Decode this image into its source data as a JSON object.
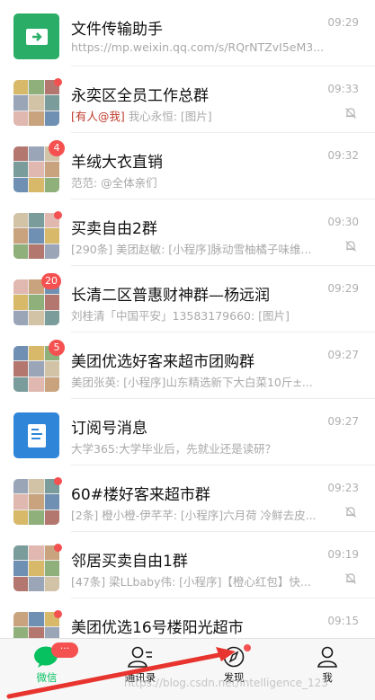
{
  "chats": [
    {
      "title": "文件传输助手",
      "subtitle": "https://mp.weixin.qq.com/s/RQrNTZvI5eM3...",
      "time": "09:29",
      "muted": false,
      "badge": "",
      "dot": false,
      "avatar_icon": "file-transfer-icon",
      "avatar_color": "#2aae67"
    },
    {
      "title": "永奕区全员工作总群",
      "mention": "[有人@我]",
      "subtitle": " 我心永恒: [图片]",
      "time": "09:33",
      "muted": true,
      "badge": "",
      "dot": true,
      "avatar_icon": "group-avatar"
    },
    {
      "title": "羊绒大衣直销",
      "subtitle": "范范: @全体亲们",
      "time": "09:32",
      "muted": false,
      "badge": "4",
      "dot": false,
      "avatar_icon": "group-avatar"
    },
    {
      "title": "买卖自由2群",
      "subtitle": "[290条] 美团赵敏: [小程序]脉动雪柚橘子味维...",
      "time": "09:30",
      "muted": true,
      "badge": "",
      "dot": true,
      "avatar_icon": "group-avatar"
    },
    {
      "title": "长清二区普惠财神群—杨远润",
      "subtitle": "刘桂清「中国平安」13583179660: [图片]",
      "time": "09:29",
      "muted": false,
      "badge": "20",
      "dot": false,
      "avatar_icon": "group-avatar"
    },
    {
      "title": "美团优选好客来超市团购群",
      "subtitle": "美团张英: [小程序]山东精选新下大白菜10斤±...",
      "time": "09:27",
      "muted": false,
      "badge": "5",
      "dot": false,
      "avatar_icon": "group-avatar"
    },
    {
      "title": "订阅号消息",
      "subtitle": "大学365:大学毕业后，先就业还是读研？",
      "time": "09:27",
      "muted": false,
      "badge": "",
      "dot": false,
      "avatar_icon": "subscription-icon",
      "avatar_color": "#2f86d8"
    },
    {
      "title": "60#楼好客来超市群",
      "subtitle": "[2条] 橙小橙-伊芊芊: [小程序]六月荷 冷鲜去皮...",
      "time": "09:23",
      "muted": true,
      "badge": "",
      "dot": true,
      "avatar_icon": "group-avatar"
    },
    {
      "title": "邻居买卖自由1群",
      "subtitle": "[47条] 梁LLbaby伟: [小程序]【橙心红包】快...",
      "time": "09:19",
      "muted": true,
      "badge": "",
      "dot": true,
      "avatar_icon": "group-avatar"
    },
    {
      "title": "美团优选16号楼阳光超市",
      "subtitle": "",
      "time": "09:15",
      "muted": false,
      "badge": "",
      "dot": true,
      "avatar_icon": "group-avatar"
    }
  ],
  "tabs": [
    {
      "label": "微信",
      "icon": "chat-bubble-icon",
      "active": true
    },
    {
      "label": "通讯录",
      "icon": "contacts-icon",
      "active": false
    },
    {
      "label": "发现",
      "icon": "compass-icon",
      "active": false
    },
    {
      "label": "我",
      "icon": "profile-icon",
      "active": false
    }
  ],
  "tab_badge": "···",
  "watermark": "https://blog.csdn.net/intelligence_123",
  "colors": {
    "accent_green": "#07c160",
    "badge_red": "#f55151",
    "mention_red": "#c0392b",
    "arrow_red": "#e8342e"
  }
}
